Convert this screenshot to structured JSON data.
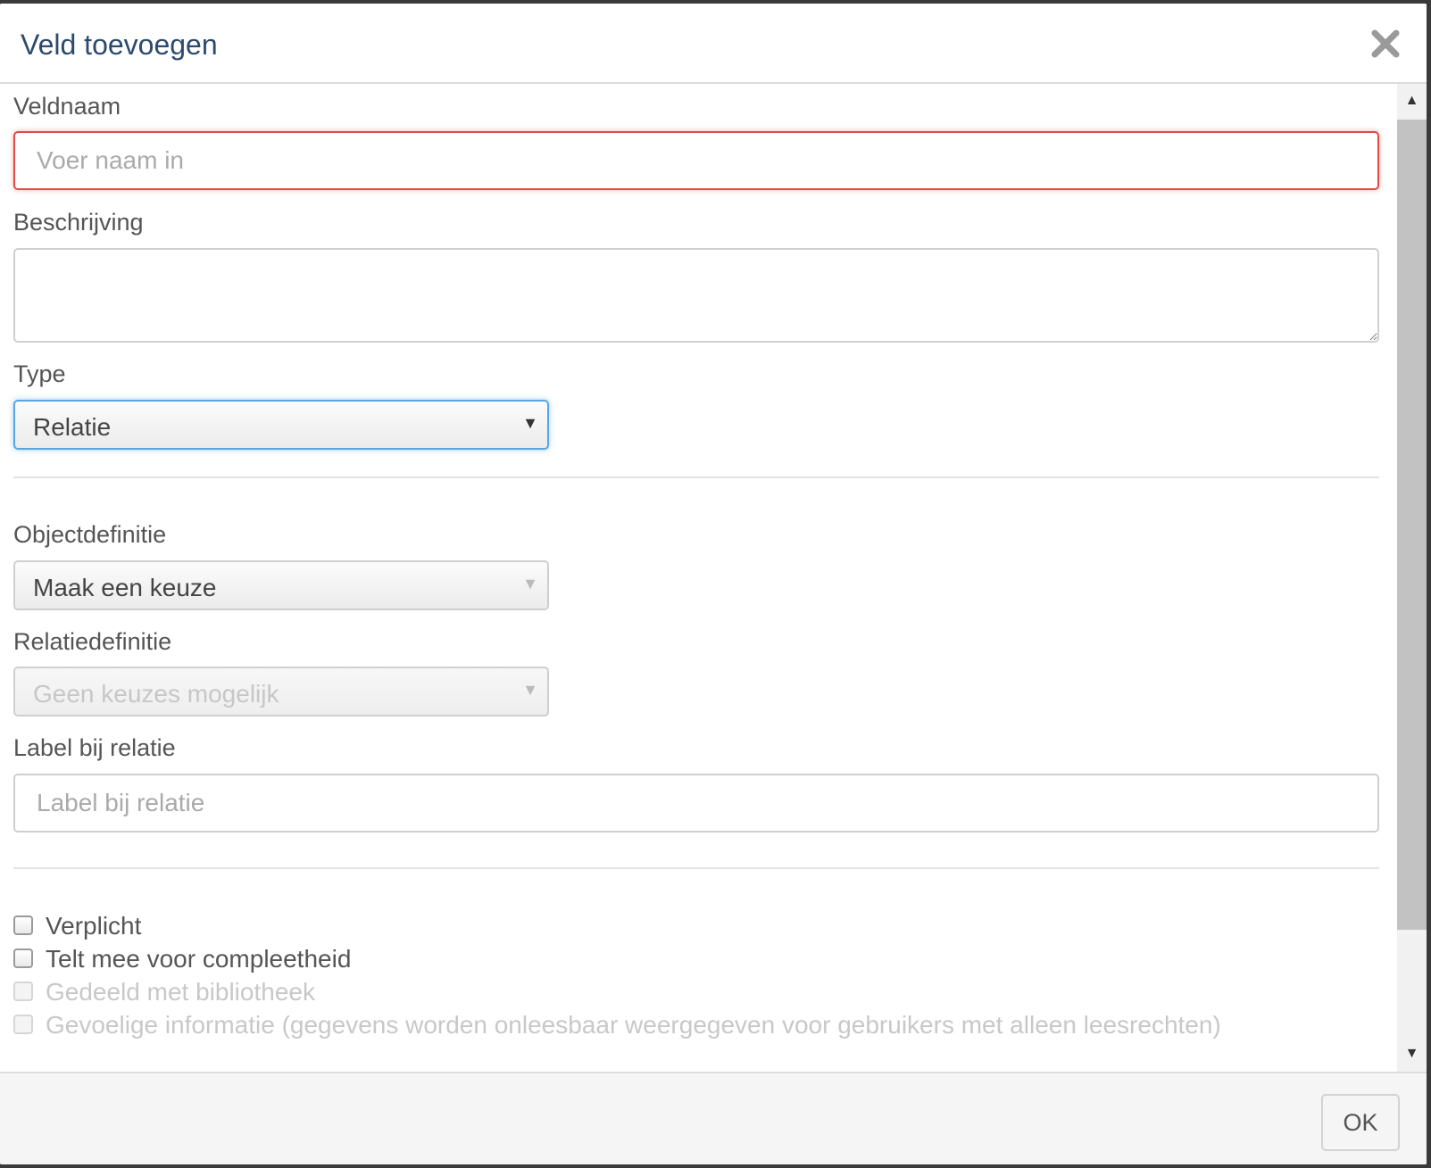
{
  "dialog": {
    "title": "Veld toevoegen",
    "close_icon": "close-icon"
  },
  "form": {
    "fieldname": {
      "label": "Veldnaam",
      "placeholder": "Voer naam in",
      "value": ""
    },
    "description": {
      "label": "Beschrijving",
      "value": ""
    },
    "type": {
      "label": "Type",
      "selected": "Relatie"
    },
    "objectdefinition": {
      "label": "Objectdefinitie",
      "selected": "Maak een keuze"
    },
    "relationdefinition": {
      "label": "Relatiedefinitie",
      "selected": "Geen keuzes mogelijk"
    },
    "relation_label": {
      "label": "Label bij relatie",
      "placeholder": "Label bij relatie",
      "value": ""
    },
    "checkboxes": [
      {
        "label": "Verplicht",
        "checked": false,
        "disabled": false
      },
      {
        "label": "Telt mee voor compleetheid",
        "checked": false,
        "disabled": false
      },
      {
        "label": "Gedeeld met bibliotheek",
        "checked": false,
        "disabled": true
      },
      {
        "label": "Gevoelige informatie (gegevens worden onleesbaar weergegeven voor gebruikers met alleen leesrechten)",
        "checked": false,
        "disabled": true
      }
    ]
  },
  "footer": {
    "ok_label": "OK"
  },
  "colors": {
    "error_border": "#e04a4a",
    "focus_border": "#5aa5e0",
    "title": "#2c4a6e"
  }
}
